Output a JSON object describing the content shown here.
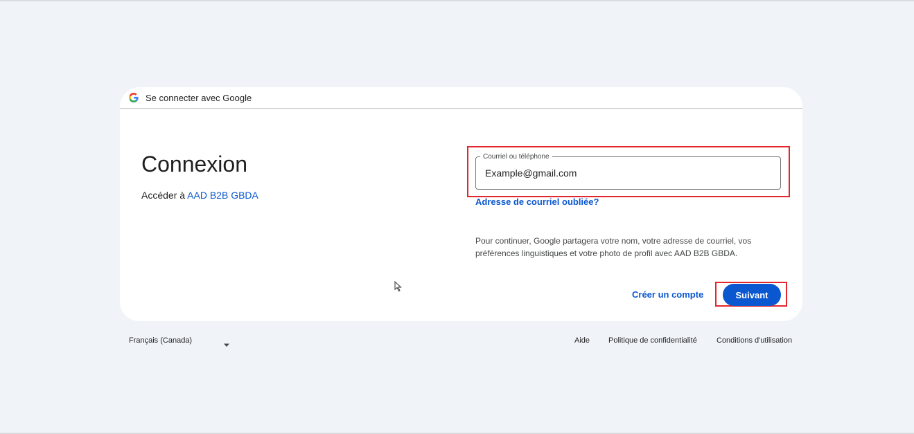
{
  "header": {
    "title": "Se connecter avec Google"
  },
  "main": {
    "headline": "Connexion",
    "subtitle_prefix": "Accéder à",
    "app_name": "AAD B2B GBDA",
    "input": {
      "label": "Courriel ou téléphone",
      "value": "Example@gmail.com"
    },
    "forgot_email": "Adresse de courriel oubliée?",
    "info": "Pour continuer, Google partagera votre nom, votre adresse de courriel, vos préférences linguistiques et votre photo de profil avec AAD B2B GBDA.",
    "create_account": "Créer un compte",
    "next_button": "Suivant"
  },
  "footer": {
    "language": "Français (Canada)",
    "help": "Aide",
    "privacy": "Politique de confidentialité",
    "terms": "Conditions d'utilisation"
  },
  "colors": {
    "accent": "#0b57d0",
    "highlight": "#e3262d",
    "background": "#f0f4f9"
  },
  "icons": [
    "google-g-icon",
    "mouse-cursor-icon",
    "caret-down-icon"
  ]
}
